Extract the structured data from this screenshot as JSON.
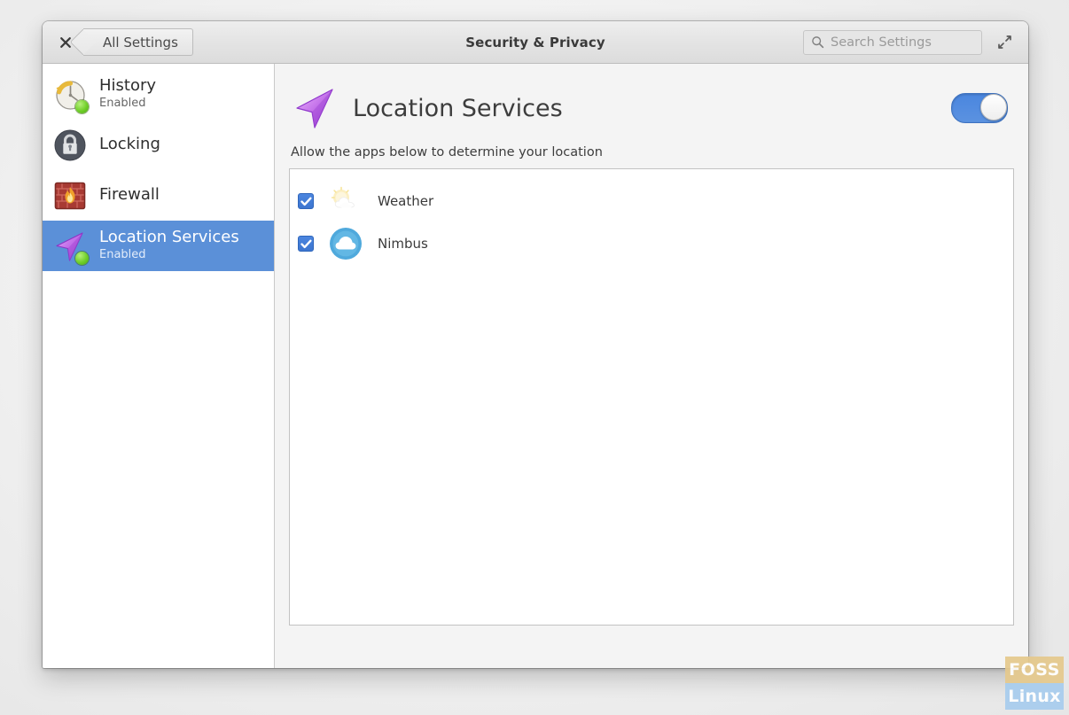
{
  "window": {
    "title": "Security & Privacy",
    "close_icon": "close-icon",
    "back_label": "All Settings",
    "maximize_icon": "maximize-icon"
  },
  "search": {
    "placeholder": "Search Settings",
    "value": "",
    "icon": "search-icon"
  },
  "sidebar": {
    "items": [
      {
        "label": "History",
        "status": "Enabled",
        "icon": "history-clock-icon",
        "selected": false,
        "has_status_dot": true
      },
      {
        "label": "Locking",
        "status": "",
        "icon": "padlock-icon",
        "selected": false,
        "has_status_dot": false
      },
      {
        "label": "Firewall",
        "status": "",
        "icon": "firewall-brick-flame-icon",
        "selected": false,
        "has_status_dot": false
      },
      {
        "label": "Location Services",
        "status": "Enabled",
        "icon": "location-arrow-icon",
        "selected": true,
        "has_status_dot": true
      }
    ]
  },
  "page": {
    "icon": "location-arrow-icon",
    "title": "Location Services",
    "toggle": {
      "label": "location-services-toggle",
      "state": "on"
    },
    "description": "Allow the apps below to determine your location",
    "apps": [
      {
        "name": "Weather",
        "icon": "sun-behind-cloud-icon",
        "checked": true
      },
      {
        "name": "Nimbus",
        "icon": "cloud-circle-icon",
        "checked": true
      }
    ]
  },
  "watermark": {
    "line1": "FOSS",
    "line2": "Linux"
  },
  "colors": {
    "accent_blue": "#5b90d8",
    "toggle_blue": "#4a86df",
    "checkbox_blue": "#3d76d0",
    "status_green": "#6fce28",
    "location_purple": "#b05de0"
  }
}
